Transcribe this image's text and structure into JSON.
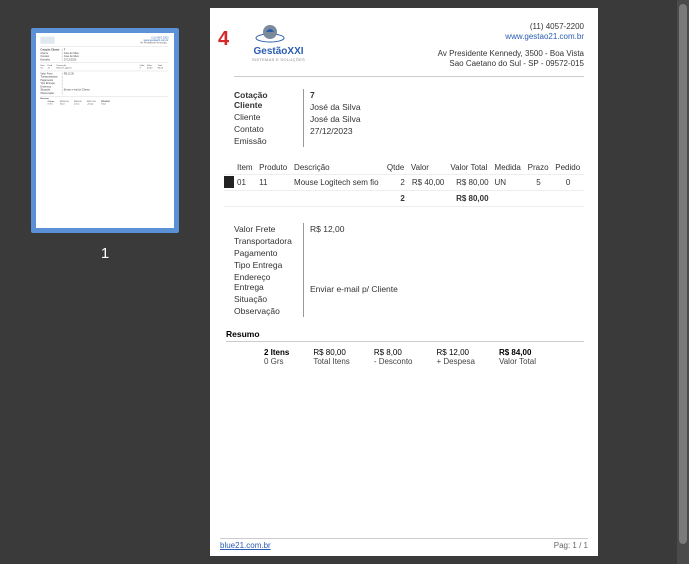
{
  "thumb_page_number": "1",
  "red_number": "4",
  "header": {
    "logo_main": "GestãoXXI",
    "logo_sub": "SISTEMAS E SOLUÇÕES",
    "phone": "(11) 4057-2200",
    "site": "www.gestao21.com.br",
    "addr1": "Av Presidente Kennedy, 3500 - Boa Vista",
    "addr2": "Sao Caetano do Sul - SP - 09572-015"
  },
  "info": {
    "labels": {
      "cotacao": "Cotação Cliente",
      "cliente": "Cliente",
      "contato": "Contato",
      "emissao": "Emissão"
    },
    "values": {
      "cotacao": "7",
      "cliente": "José da Silva",
      "contato": "José da Silva",
      "emissao": "27/12/2023"
    }
  },
  "table": {
    "headers": {
      "item": "Item",
      "produto": "Produto",
      "descricao": "Descrição",
      "qtde": "Qtde",
      "valor": "Valor",
      "valor_total": "Valor Total",
      "medida": "Medida",
      "prazo": "Prazo",
      "pedido": "Pedido"
    },
    "row": {
      "item": "01",
      "produto": "11",
      "descricao": "Mouse Logitech sem fio",
      "qtde": "2",
      "valor": "R$ 40,00",
      "valor_total": "R$ 80,00",
      "medida": "UN",
      "prazo": "5",
      "pedido": "0"
    },
    "totals": {
      "qtde": "2",
      "valor_total": "R$ 80,00"
    }
  },
  "ship": {
    "labels": {
      "frete": "Valor Frete",
      "transp": "Transportadora",
      "pagto": "Pagamento",
      "tipo": "Tipo Entrega",
      "end": "Endereço Entrega",
      "sit": "Situação",
      "obs": "Observação"
    },
    "values": {
      "frete": "R$ 12,00",
      "transp": "",
      "pagto": "",
      "tipo": "",
      "end": "",
      "sit": "Enviar e-mail p/ Cliente",
      "obs": ""
    }
  },
  "resumo": {
    "title": "Resumo",
    "c1": {
      "v": "2 Itens",
      "l": "0 Grs"
    },
    "c2": {
      "v": "R$ 80,00",
      "l": "Total Itens"
    },
    "c3": {
      "v": "R$ 8,00",
      "l": "- Desconto"
    },
    "c4": {
      "v": "R$ 12,00",
      "l": "+ Despesa"
    },
    "c5": {
      "v": "R$ 84,00",
      "l": "Valor Total"
    }
  },
  "footer": {
    "site": "blue21.com.br",
    "page": "Pag: 1 / 1"
  }
}
